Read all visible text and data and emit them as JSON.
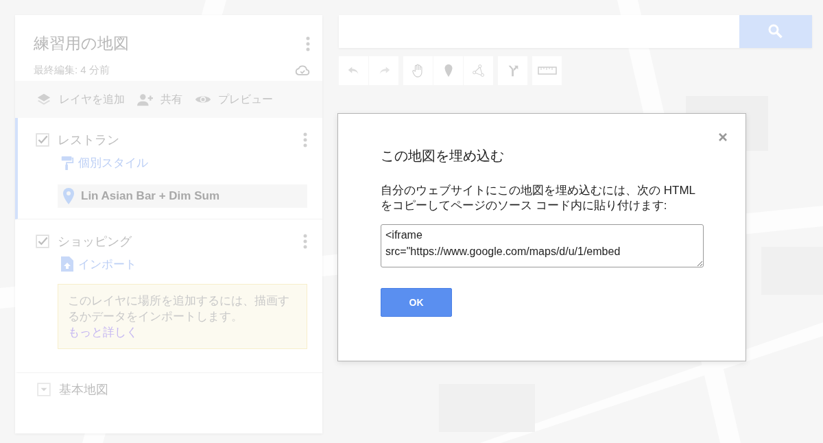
{
  "map_title": "練習用の地図",
  "last_edited": "最終編集: 4 分前",
  "actions": [
    {
      "kind": "add_layer",
      "label": "レイヤを追加"
    },
    {
      "kind": "share",
      "label": "共有"
    },
    {
      "kind": "preview",
      "label": "プレビュー"
    }
  ],
  "layers": [
    {
      "name": "レストラン",
      "checked": true,
      "selected": true,
      "link": {
        "kind": "style",
        "label": "個別スタイル"
      },
      "places": [
        {
          "name": "Lin Asian Bar + Dim Sum"
        }
      ]
    },
    {
      "name": "ショッピング",
      "checked": true,
      "selected": false,
      "link": {
        "kind": "import",
        "label": "インポート"
      },
      "hint": {
        "text": "このレイヤに場所を追加するには、描画するかデータをインポートします。",
        "link": "もっと詳しく"
      }
    }
  ],
  "base_map": {
    "label": "基本地図",
    "expanded": false
  },
  "dialog": {
    "title": "この地図を埋め込む",
    "message": "自分のウェブサイトにこの地図を埋め込むには、次の HTML をコピーしてページのソース コード内に貼り付けます:",
    "code": "<iframe\nsrc=\"https://www.google.com/maps/d/u/1/embed",
    "ok": "OK"
  }
}
